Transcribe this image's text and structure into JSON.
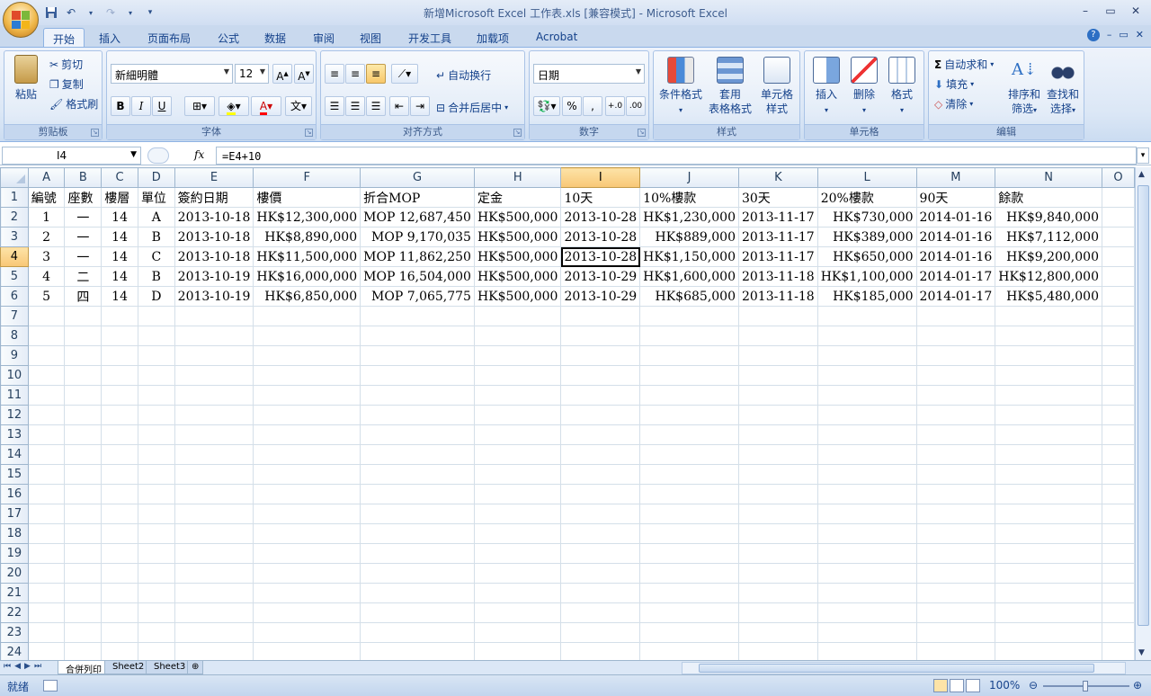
{
  "window": {
    "title": "新增Microsoft Excel 工作表.xls  [兼容模式] - Microsoft Excel",
    "controls": [
      "–",
      "▭",
      "✕"
    ]
  },
  "ribbon": {
    "tabs": [
      "开始",
      "插入",
      "页面布局",
      "公式",
      "数据",
      "审阅",
      "视图",
      "开发工具",
      "加载项",
      "Acrobat"
    ],
    "clipboard": {
      "paste": "粘贴",
      "cut": "剪切",
      "copy": "复制",
      "format_painter": "格式刷",
      "label": "剪贴板"
    },
    "font": {
      "name": "新細明體",
      "size": "12",
      "label": "字体"
    },
    "alignment": {
      "wrap": "自动换行",
      "merge": "合并后居中",
      "label": "对齐方式"
    },
    "number": {
      "format": "日期",
      "label": "数字"
    },
    "styles": {
      "conditional": "条件格式",
      "table_a": "套用",
      "table_b": "表格格式",
      "cell_a": "单元格",
      "cell_b": "样式",
      "label": "样式"
    },
    "cells": {
      "insert": "插入",
      "delete": "删除",
      "format": "格式",
      "label": "单元格"
    },
    "editing": {
      "autosum": "自动求和",
      "fill": "填充",
      "clear": "清除",
      "sort_a": "排序和",
      "sort_b": "筛选",
      "find_a": "查找和",
      "find_b": "选择",
      "label": "编辑"
    }
  },
  "formula_bar": {
    "cell_ref": "I4",
    "fx": "fx",
    "formula": "=E4+10"
  },
  "grid": {
    "columns": [
      "A",
      "B",
      "C",
      "D",
      "E",
      "F",
      "G",
      "H",
      "I",
      "J",
      "K",
      "L",
      "M",
      "N",
      "O"
    ],
    "selected_col": "I",
    "selected_row": 4,
    "header_row": [
      "編號",
      "座數",
      "樓層",
      "單位",
      "簽約日期",
      "樓價",
      "折合MOP",
      "定金",
      "10天",
      "10%樓款",
      "30天",
      "20%樓款",
      "90天",
      "餘款"
    ],
    "rows": [
      [
        "1",
        "一",
        "14",
        "A",
        "2013-10-18",
        "HK$12,300,000",
        "MOP 12,687,450",
        "HK$500,000",
        "2013-10-28",
        "HK$1,230,000",
        "2013-11-17",
        "HK$730,000",
        "2014-01-16",
        "HK$9,840,000"
      ],
      [
        "2",
        "一",
        "14",
        "B",
        "2013-10-18",
        "HK$8,890,000",
        "MOP 9,170,035",
        "HK$500,000",
        "2013-10-28",
        "HK$889,000",
        "2013-11-17",
        "HK$389,000",
        "2014-01-16",
        "HK$7,112,000"
      ],
      [
        "3",
        "一",
        "14",
        "C",
        "2013-10-18",
        "HK$11,500,000",
        "MOP 11,862,250",
        "HK$500,000",
        "2013-10-28",
        "HK$1,150,000",
        "2013-11-17",
        "HK$650,000",
        "2014-01-16",
        "HK$9,200,000"
      ],
      [
        "4",
        "二",
        "14",
        "B",
        "2013-10-19",
        "HK$16,000,000",
        "MOP 16,504,000",
        "HK$500,000",
        "2013-10-29",
        "HK$1,600,000",
        "2013-11-18",
        "HK$1,100,000",
        "2014-01-17",
        "HK$12,800,000"
      ],
      [
        "5",
        "四",
        "14",
        "D",
        "2013-10-19",
        "HK$6,850,000",
        "MOP 7,065,775",
        "HK$500,000",
        "2013-10-29",
        "HK$685,000",
        "2013-11-18",
        "HK$185,000",
        "2014-01-17",
        "HK$5,480,000"
      ]
    ],
    "row_numbers": [
      "1",
      "2",
      "3",
      "4",
      "5",
      "6",
      "7",
      "8",
      "9",
      "10",
      "11",
      "12",
      "13",
      "14",
      "15",
      "16",
      "17",
      "18",
      "19",
      "20",
      "21",
      "22",
      "23",
      "24"
    ]
  },
  "sheets": [
    "合併列印",
    "Sheet2",
    "Sheet3"
  ],
  "status": {
    "text": "就绪",
    "zoom": "100%"
  }
}
